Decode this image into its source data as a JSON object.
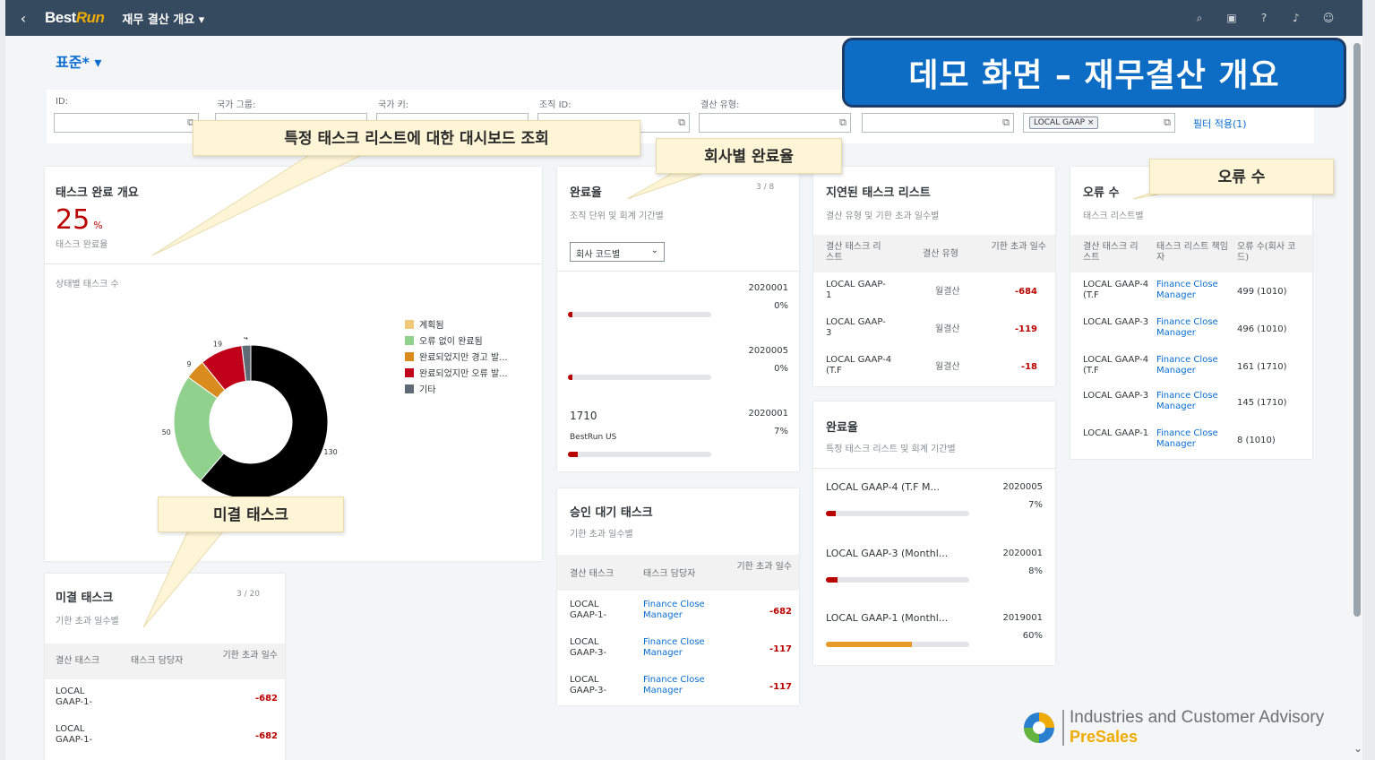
{
  "shell": {
    "back_icon": "chevron-left-icon",
    "logo_prefix": "Best",
    "logo_suffix": "Run",
    "app_title": "재무 결산 개요 ▾",
    "icons": [
      "search-icon",
      "copilot-icon",
      "help-icon",
      "bell-icon",
      "user-icon"
    ]
  },
  "variant": {
    "label": "표준* ▾"
  },
  "filters": [
    {
      "label": "ID:",
      "value": ""
    },
    {
      "label": "국가 그룹:",
      "value": ""
    },
    {
      "label": "국가 키:",
      "value": ""
    },
    {
      "label": "조직 ID:",
      "value": ""
    },
    {
      "label": "결산 유형:",
      "value": ""
    },
    {
      "label": "",
      "value": ""
    },
    {
      "label": "",
      "value": "",
      "token": "LOCAL GAAP ×"
    }
  ],
  "filters_adapt": "필터 적용(1)",
  "demo_banner": "데모 화면 – 재무결산 개요",
  "callouts": {
    "c1": "특정 태스크 리스트에 대한 대시보드 조회",
    "c2": "회사별 완료율",
    "c3": "오류 수",
    "c4": "미결 태스크"
  },
  "card_overview": {
    "title": "태스크 완료 개요",
    "kpi_value": "25",
    "kpi_unit": "%",
    "kpi_label": "태스크 완료율",
    "chart_title": "상태별 태스크 수"
  },
  "chart_data": {
    "type": "pie",
    "donut": true,
    "title": "상태별 태스크 수",
    "categories": [
      "계획됨",
      "오류 없이 완료됨",
      "완료되었지만 경고 발...",
      "완료되었지만 오류 발...",
      "기타"
    ],
    "values": [
      0,
      50,
      9,
      19,
      4,
      130
    ],
    "slices": [
      {
        "name": "오류 없이 완료됨",
        "value": 50,
        "color": "#8fd18d"
      },
      {
        "name": "완료되었지만 경고 발...",
        "value": 9,
        "color": "#d98b1e"
      },
      {
        "name": "완료되었지만 오류 발...",
        "value": 19,
        "color": "#c0001b"
      },
      {
        "name": "기타",
        "value": 4,
        "color": "#5e6a74"
      },
      {
        "name": "",
        "value": 130,
        "color": "#000000"
      }
    ],
    "slice_labels": [
      "50",
      "9",
      "19",
      "4",
      "130"
    ],
    "legend": [
      {
        "label": "계획됨",
        "color": "#f1c97a"
      },
      {
        "label": "오류 없이 완료됨",
        "color": "#8fd18d"
      },
      {
        "label": "완료되었지만 경고 발...",
        "color": "#d98b1e"
      },
      {
        "label": "완료되었지만 오류 발...",
        "color": "#c0001b"
      },
      {
        "label": "기타",
        "color": "#5e6a74"
      }
    ],
    "legend_position": "right"
  },
  "card_open": {
    "title": "미결 태스크",
    "count": "3 / 20",
    "subtitle": "기한 초과 일수별",
    "headers": [
      "결산 태스크",
      "태스크 담당자",
      "기한 초과 일수"
    ],
    "rows": [
      {
        "task": "LOCAL GAAP-1-",
        "days": "-682"
      },
      {
        "task": "LOCAL GAAP-1-",
        "days": "-682"
      }
    ]
  },
  "card_completion": {
    "title": "완료율",
    "count": "3 / 8",
    "subtitle": "조직 단위 및 회계 기간별",
    "dropdown": "회사 코드별",
    "items": [
      {
        "name": "",
        "sub": "",
        "period": "2020001",
        "percent": "0%",
        "fill": 0.01
      },
      {
        "name": "",
        "sub": "",
        "period": "2020005",
        "percent": "0%",
        "fill": 0.01
      },
      {
        "name": "1710",
        "sub": "BestRun US",
        "period": "2020001",
        "percent": "7%",
        "fill": 0.07
      }
    ]
  },
  "card_approval": {
    "title": "승인 대기 태스크",
    "subtitle": "기한 초과 일수별",
    "headers": [
      "결산 태스크",
      "태스크 담당자",
      "기한 초과 일수"
    ],
    "rows": [
      {
        "task": "LOCAL GAAP-1-",
        "owner": "Finance Close Manager",
        "days": "-682"
      },
      {
        "task": "LOCAL GAAP-3-",
        "owner": "Finance Close Manager",
        "days": "-117"
      },
      {
        "task": "LOCAL GAAP-3-",
        "owner": "Finance Close Manager",
        "days": "-117"
      }
    ]
  },
  "card_delayed": {
    "title": "지연된 태스크 리스트",
    "subtitle": "결산 유형 및 기한 초과 일수별",
    "headers": [
      "결산 태스크 리스트",
      "결산 유형",
      "기한 초과 일수"
    ],
    "rows": [
      {
        "task": "LOCAL GAAP-1",
        "type": "월결산",
        "days": "-684"
      },
      {
        "task": "LOCAL GAAP-3",
        "type": "월결산",
        "days": "-119"
      },
      {
        "task": "LOCAL GAAP-4 (T.F",
        "type": "월결산",
        "days": "-18"
      }
    ]
  },
  "card_rate": {
    "title": "완료율",
    "subtitle": "특정 태스크 리스트 및 회계 기간별",
    "items": [
      {
        "name": "LOCAL GAAP-4 (T.F M...",
        "period": "2020005",
        "percent": "7%",
        "fill": 0.07,
        "color": "red"
      },
      {
        "name": "LOCAL GAAP-3 (Monthl...",
        "period": "2020001",
        "percent": "8%",
        "fill": 0.08,
        "color": "red"
      },
      {
        "name": "LOCAL GAAP-1 (Monthl...",
        "period": "2019001",
        "percent": "60%",
        "fill": 0.6,
        "color": "orange"
      }
    ]
  },
  "card_errors": {
    "title": "오류 수",
    "subtitle": "태스크 리스트별",
    "headers": [
      "결산 태스크 리스트",
      "태스크 리스트 책임자",
      "오류 수(회사 코드)"
    ],
    "rows": [
      {
        "task": "LOCAL GAAP-4 (T.F",
        "owner": "Finance Close Manager",
        "count": "499 (1010)"
      },
      {
        "task": "LOCAL GAAP-3",
        "owner": "Finance Close Manager",
        "count": "496 (1010)"
      },
      {
        "task": "LOCAL GAAP-4 (T.F",
        "owner": "Finance Close Manager",
        "count": "161 (1710)"
      },
      {
        "task": "LOCAL GAAP-3",
        "owner": "Finance Close Manager",
        "count": "145 (1710)"
      },
      {
        "task": "LOCAL GAAP-1",
        "owner": "Finance Close Manager",
        "count": "8 (1010)"
      }
    ]
  },
  "watermark": {
    "line1": "Industries and Customer Advisory",
    "line2": "PreSales"
  }
}
